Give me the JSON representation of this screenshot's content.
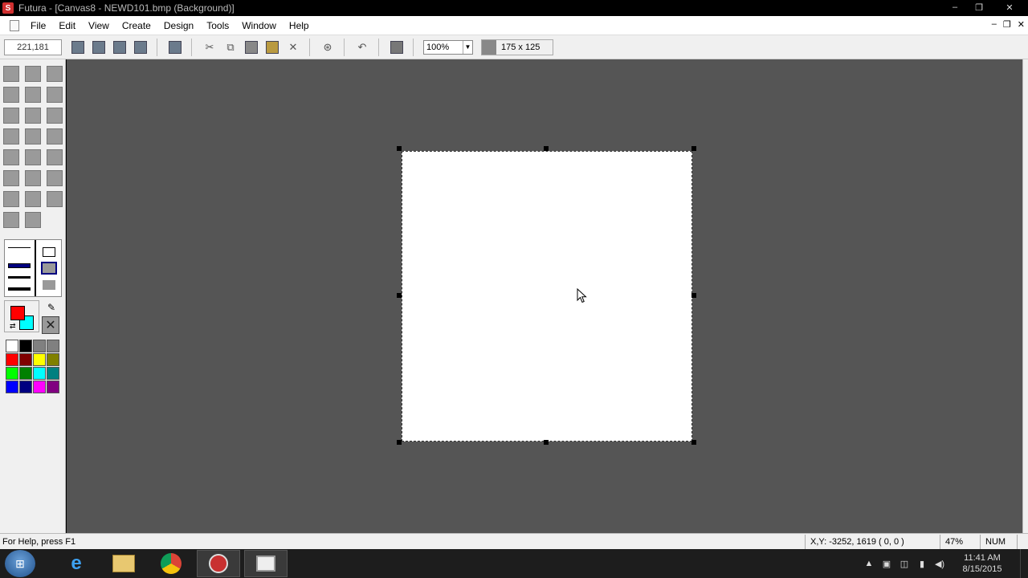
{
  "window": {
    "app_initial": "S",
    "title": "Futura - [Canvas8 - NEWD101.bmp (Background)]",
    "controls": {
      "minimize": "–",
      "maximize": "❐",
      "close": "✕"
    }
  },
  "menubar": {
    "items": [
      "File",
      "Edit",
      "View",
      "Create",
      "Design",
      "Tools",
      "Window",
      "Help"
    ],
    "mdi_controls": {
      "minimize": "–",
      "restore": "❐",
      "close": "✕"
    }
  },
  "toolbar": {
    "coords": "221,181",
    "zoom": "100%",
    "canvas_size": "175 x 125",
    "icons": [
      "save-icon",
      "import-icon",
      "image-icon",
      "export-icon",
      "page-icon",
      "cut-icon",
      "copy-icon",
      "paste-icon",
      "paste-special-icon",
      "delete-icon",
      "transform-icon",
      "undo-icon",
      "resize-icon"
    ]
  },
  "palette": {
    "foreground": "#ff0000",
    "background": "#00ffff",
    "colors": [
      "#ffffff",
      "#000000",
      "#808080",
      "#808080",
      "#ff0000",
      "#800000",
      "#ffff00",
      "#808000",
      "#00ff00",
      "#008000",
      "#00ffff",
      "#008080",
      "#0000ff",
      "#000080",
      "#ff00ff",
      "#800080"
    ]
  },
  "workspace": {
    "background": "#555555"
  },
  "statusbar": {
    "help": "For Help, press F1",
    "xy": "X,Y: -3252, 1619  ( 0, 0 )",
    "zoom_pct": "47%",
    "num": "NUM"
  },
  "taskbar": {
    "time": "11:41 AM",
    "date": "8/15/2015"
  }
}
